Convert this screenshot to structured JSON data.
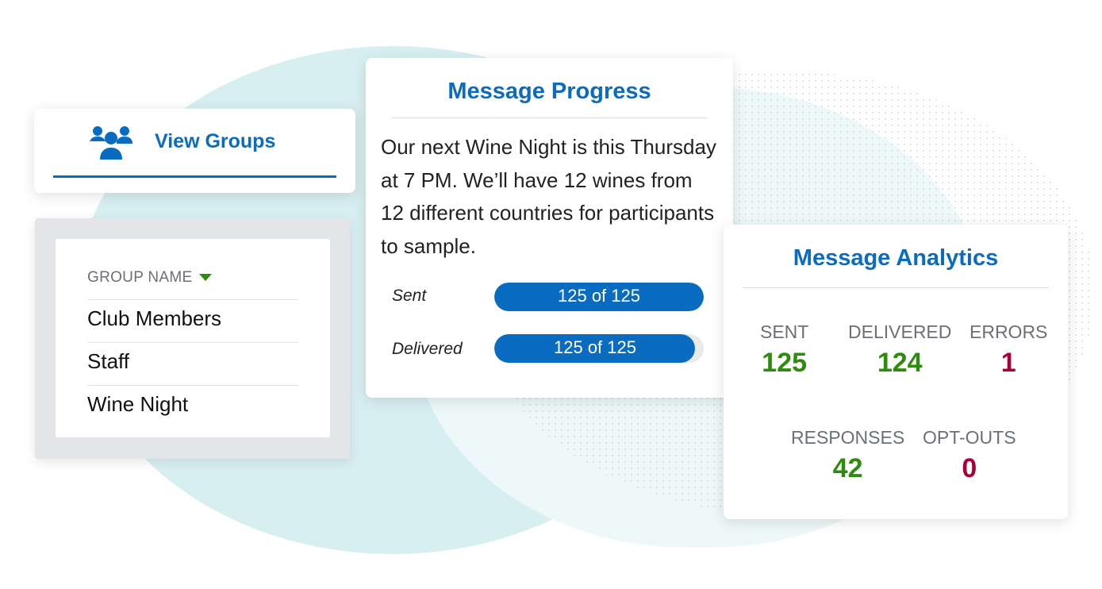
{
  "view_groups": {
    "label": "View Groups",
    "icon": "users-icon"
  },
  "groups": {
    "header": "GROUP NAME",
    "sort_icon": "caret-down-icon",
    "items": [
      "Club Members",
      "Staff",
      "Wine Night"
    ]
  },
  "progress": {
    "title": "Message Progress",
    "message": "Our next Wine Night is this Thursday at 7 PM. We’ll have 12 wines from 12 different countries for participants to sample.",
    "rows": [
      {
        "label": "Sent",
        "value": "125 of 125",
        "percent": 100
      },
      {
        "label": "Delivered",
        "value": "125 of 125",
        "percent": 96
      }
    ]
  },
  "analytics": {
    "title": "Message Analytics",
    "stats": [
      {
        "label": "SENT",
        "value": "125",
        "status": "good"
      },
      {
        "label": "DELIVERED",
        "value": "124",
        "status": "good"
      },
      {
        "label": "ERRORS",
        "value": "1",
        "status": "bad"
      },
      {
        "label": "RESPONSES",
        "value": "42",
        "status": "good"
      },
      {
        "label": "OPT-OUTS",
        "value": "0",
        "status": "bad"
      }
    ]
  },
  "colors": {
    "brand": "#0a6cc0",
    "good": "#2e8b0e",
    "bad": "#a8003a"
  }
}
